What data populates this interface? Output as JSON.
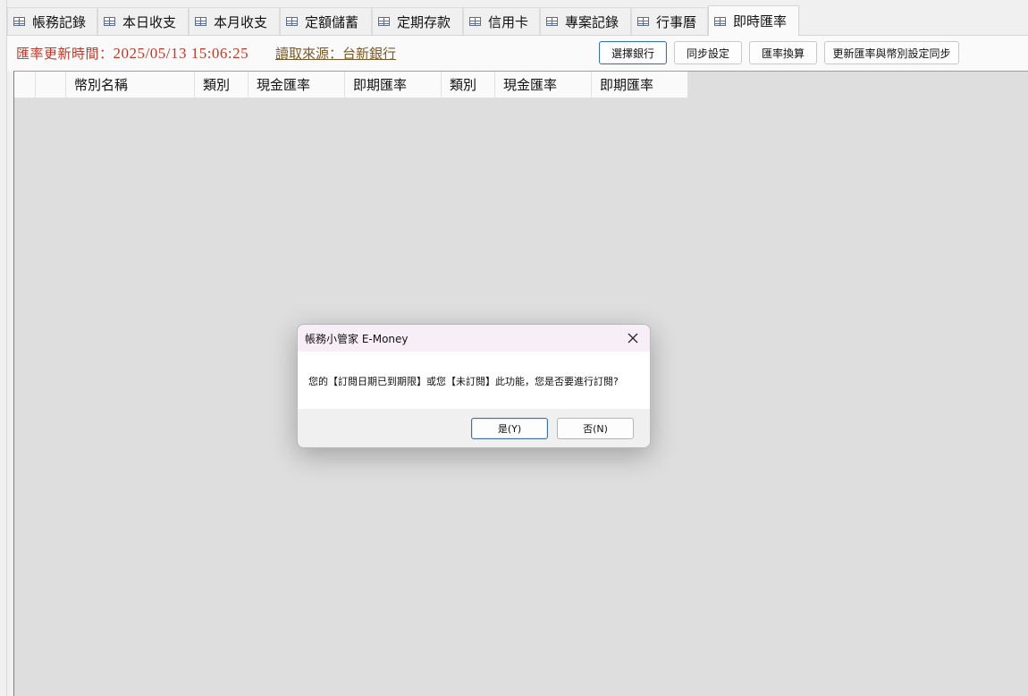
{
  "tabs": [
    {
      "label": "帳務記錄",
      "active": false
    },
    {
      "label": "本日收支",
      "active": false
    },
    {
      "label": "本月收支",
      "active": false
    },
    {
      "label": "定額儲蓄",
      "active": false
    },
    {
      "label": "定期存款",
      "active": false
    },
    {
      "label": "信用卡",
      "active": false
    },
    {
      "label": "專案記錄",
      "active": false
    },
    {
      "label": "行事曆",
      "active": false
    },
    {
      "label": "即時匯率",
      "active": true
    }
  ],
  "rate_info": {
    "update_label": "匯率更新時間：",
    "update_time": "2025/05/13  15:06:25",
    "source_link": "讀取來源：台新銀行"
  },
  "toolbar": {
    "select_bank": "選擇銀行",
    "sync_settings": "同步設定",
    "rate_convert": "匯率換算",
    "update_sync": "更新匯率與幣別設定同步"
  },
  "grid": {
    "columns": [
      "",
      "",
      "幣別名稱",
      "類別",
      "現金匯率",
      "即期匯率",
      "類別",
      "現金匯率",
      "即期匯率"
    ]
  },
  "dialog": {
    "title": "帳務小管家 E-Money",
    "message": "您的【訂閱日期已到期限】或您【未訂閱】此功能，您是否要進行訂閱?",
    "yes_label": "是(Y)",
    "no_label": "否(N)"
  },
  "colors": {
    "time_text": "#c0392b",
    "link_text": "#7a5a2a",
    "dialog_title_bg": "#f7eef7",
    "grid_bg": "#dedede"
  }
}
